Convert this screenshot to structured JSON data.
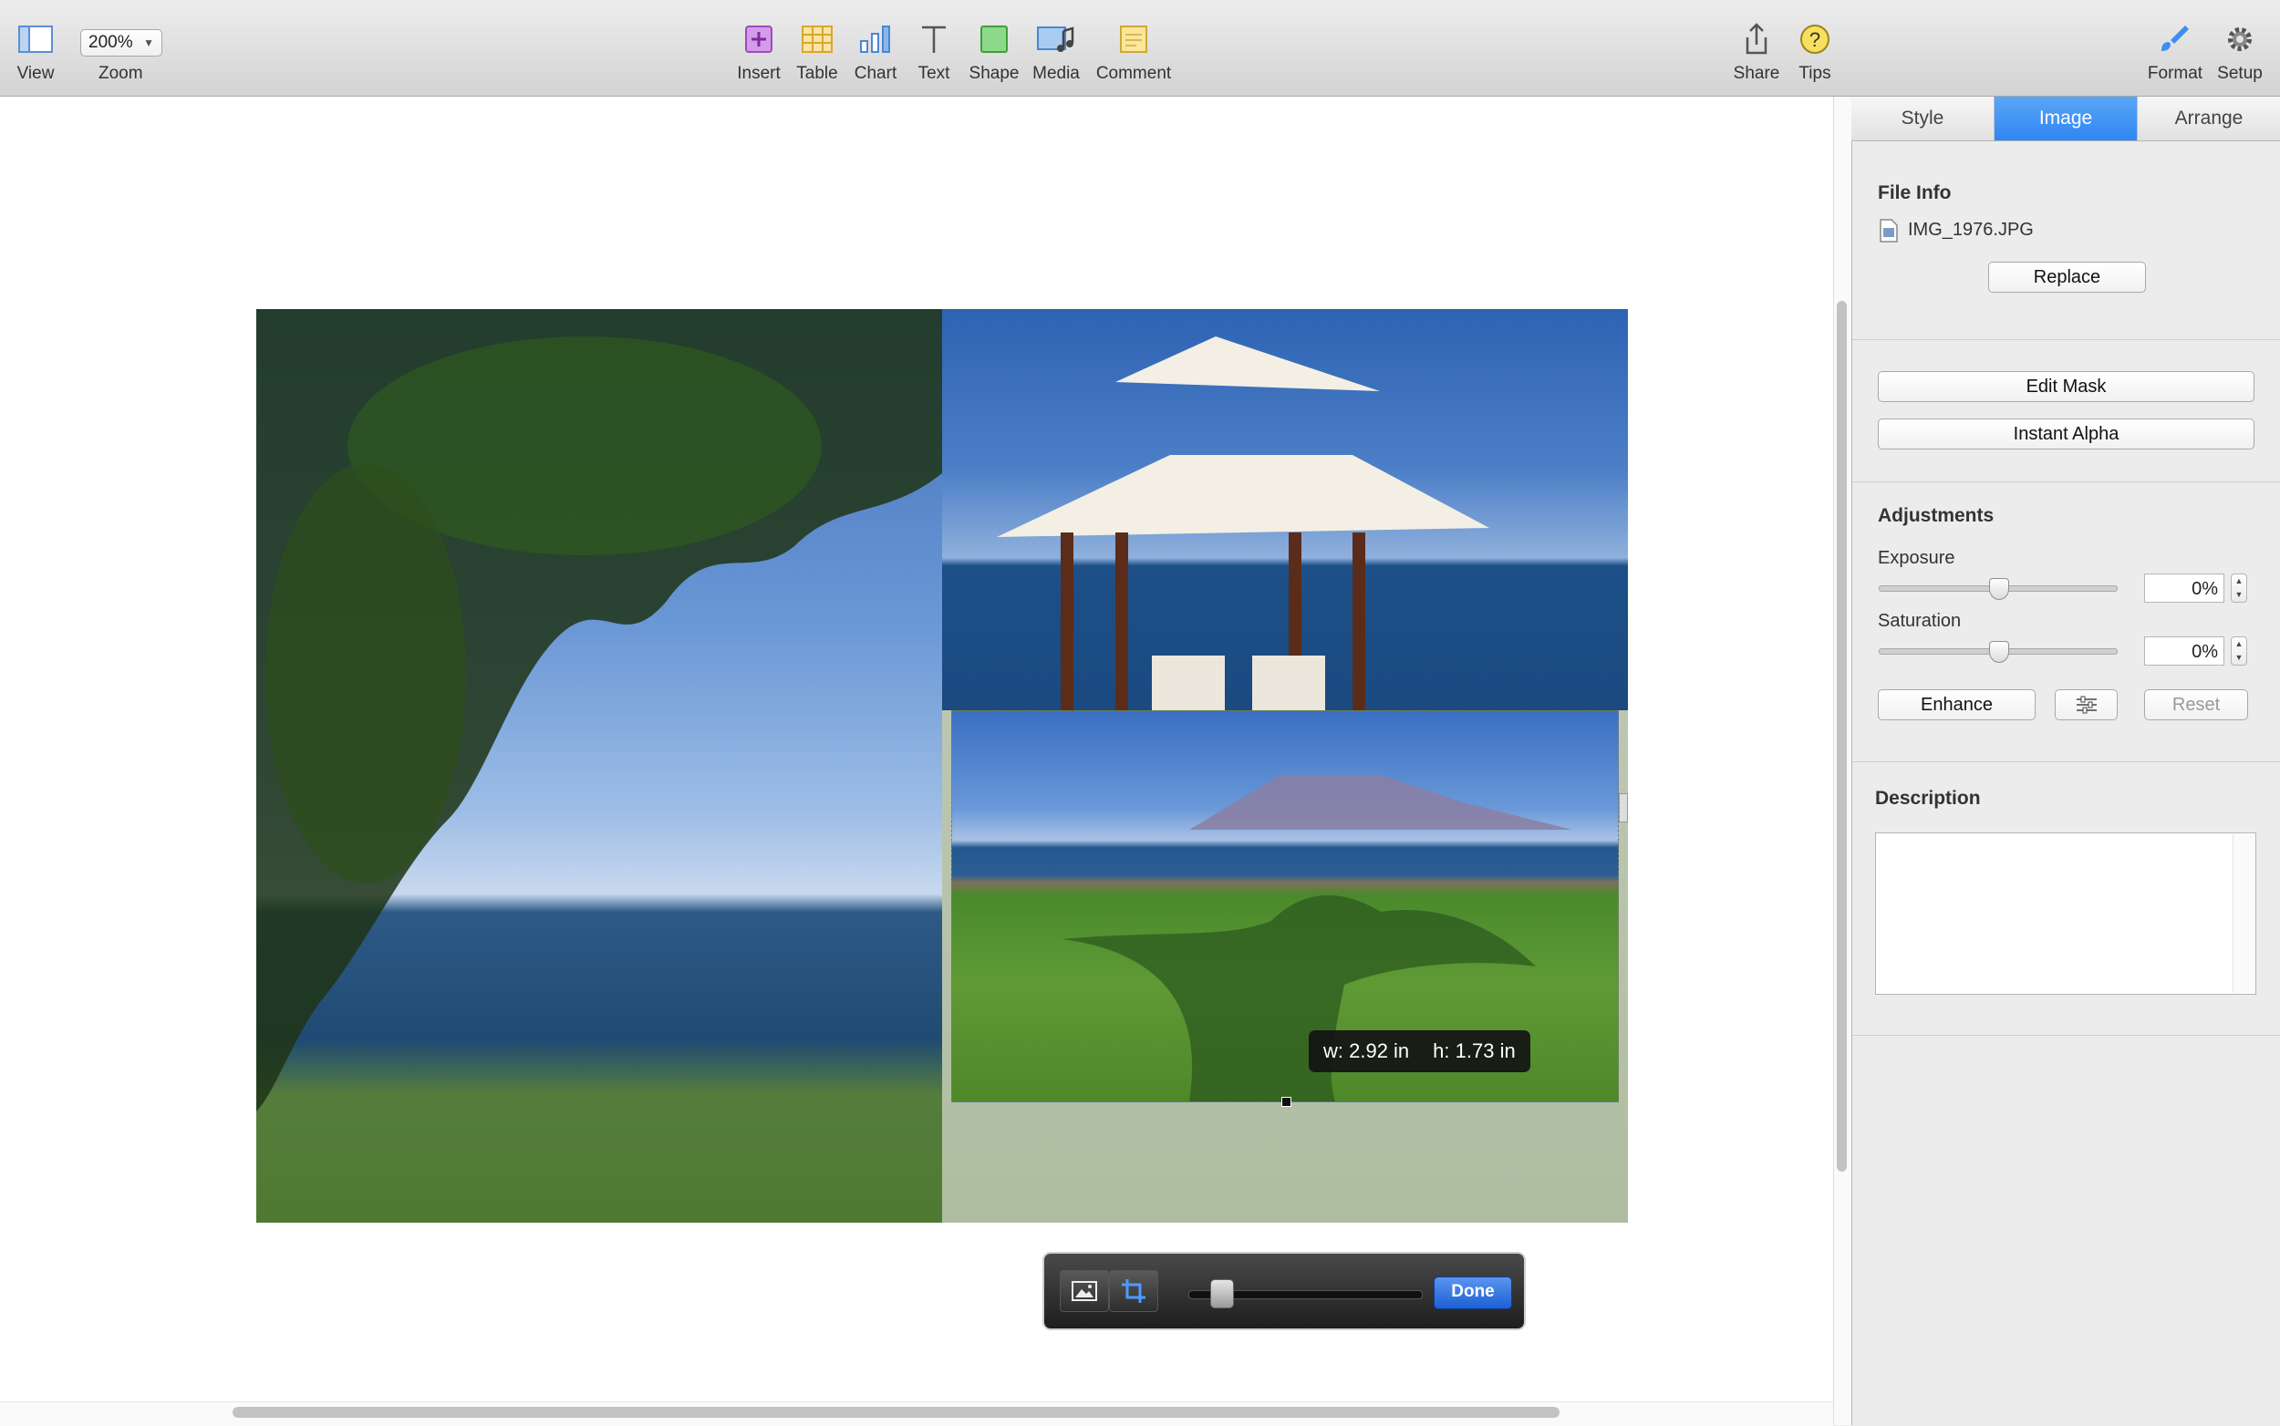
{
  "toolbar": {
    "view_label": "View",
    "zoom_value": "200%",
    "zoom_label": "Zoom",
    "insert_label": "Insert",
    "table_label": "Table",
    "chart_label": "Chart",
    "text_label": "Text",
    "shape_label": "Shape",
    "media_label": "Media",
    "comment_label": "Comment",
    "share_label": "Share",
    "tips_label": "Tips",
    "format_label": "Format",
    "setup_label": "Setup"
  },
  "canvas": {
    "dimension_tooltip": {
      "width": "w: 2.92 in",
      "height": "h: 1.73 in"
    },
    "mask_bar": {
      "done_label": "Done",
      "scale": 0.15
    }
  },
  "inspector": {
    "tabs": [
      {
        "label": "Style",
        "active": false
      },
      {
        "label": "Image",
        "active": true
      },
      {
        "label": "Arrange",
        "active": false
      }
    ],
    "file_info": {
      "title": "File Info",
      "file_name": "IMG_1976.JPG",
      "replace_label": "Replace"
    },
    "mask": {
      "edit_mask_label": "Edit Mask",
      "instant_alpha_label": "Instant Alpha"
    },
    "adjustments": {
      "title": "Adjustments",
      "exposure_label": "Exposure",
      "exposure_value": "0%",
      "saturation_label": "Saturation",
      "saturation_value": "0%",
      "enhance_label": "Enhance",
      "reset_label": "Reset"
    },
    "description": {
      "title": "Description",
      "text": ""
    }
  },
  "colors": {
    "accent": "#2f86f2",
    "done_button": "#1d5fd3"
  }
}
